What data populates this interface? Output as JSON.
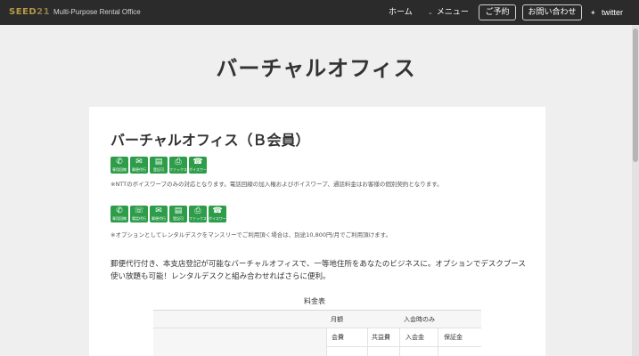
{
  "header": {
    "logo_text": "SEED",
    "logo_number": "21",
    "tagline": "Multi-Purpose Rental Office",
    "nav": {
      "home": "ホーム",
      "menu": "メニュー",
      "reserve": "ご予約",
      "contact": "お問い合わせ",
      "twitter": "twitter"
    }
  },
  "page": {
    "title": "バーチャルオフィス"
  },
  "plan": {
    "title": "バーチャルオフィス（Ｂ会員）",
    "icons_row1": [
      {
        "icon": "phone-icon",
        "label": "専用回線"
      },
      {
        "icon": "mail-receipt-icon",
        "label": "郵便代行"
      },
      {
        "icon": "registration-icon",
        "label": "登記可"
      },
      {
        "icon": "fax-icon",
        "label": "ファックス"
      },
      {
        "icon": "voiceworp-icon",
        "label": "ボイスワープ"
      }
    ],
    "note1": "※NTTのボイスワープのみの対応となります。電話回線の加入権およびボイスワープ、通話料金はお客様の個別契約となります。",
    "icons_row2": [
      {
        "icon": "phone-icon",
        "label": "専用回線"
      },
      {
        "icon": "phone-agent-icon",
        "label": "電話代行"
      },
      {
        "icon": "mail-receipt-icon",
        "label": "郵便代行"
      },
      {
        "icon": "registration-icon",
        "label": "登記可"
      },
      {
        "icon": "fax-icon",
        "label": "ファックス"
      },
      {
        "icon": "voiceworp-icon",
        "label": "ボイスワープ"
      }
    ],
    "note2": "※オプションとしてレンタルデスクをマンスリーでご利用頂く場合は、別途10,800円/月でご利用頂けます。",
    "description_line1": "郵便代行付き、本支店登記が可能なバーチャルオフィスで、一等地住所をあなたのビジネスに。オプションでデスクブース",
    "description_line2": "使い放題も可能！レンタルデスクと組み合わせればさらに便利。"
  },
  "price_table": {
    "caption": "料金表",
    "group_monthly": "月額",
    "group_join": "入会時のみ",
    "col_fee": "会費",
    "col_common": "共益費",
    "col_join_fee": "入会金",
    "col_deposit": "保証金"
  },
  "colors": {
    "header_bg": "#2b2b2b",
    "logo": "#b79a45",
    "icon_green": "#2e9d4a",
    "page_bg": "#efefef"
  }
}
